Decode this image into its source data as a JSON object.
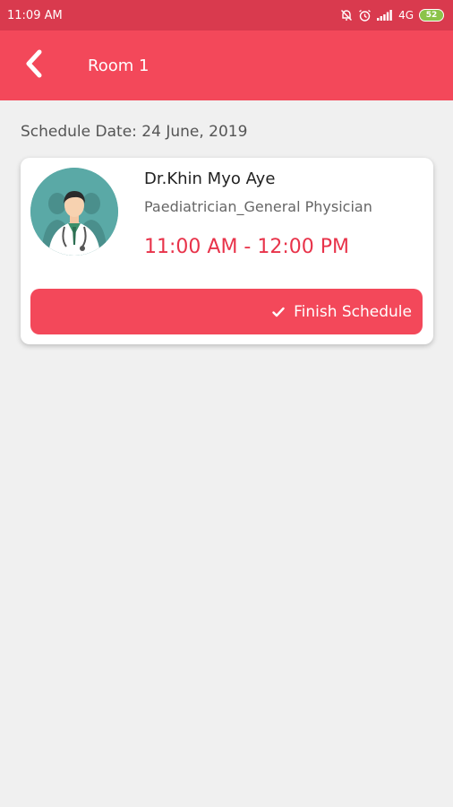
{
  "status_bar": {
    "time": "11:09 AM",
    "network": "4G",
    "battery": "52"
  },
  "header": {
    "title": "Room 1"
  },
  "schedule": {
    "date_line": "Schedule Date: 24 June, 2019"
  },
  "appointment": {
    "doctor_name": "Dr.Khin Myo Aye",
    "speciality": "Paediatrician_General Physician",
    "time_range": "11:00 AM - 12:00 PM",
    "finish_label": "Finish Schedule"
  },
  "colors": {
    "status_bar": "#d93a4e",
    "primary": "#f3485a",
    "time_text": "#e8334a",
    "avatar_bg": "#5aa9a6"
  },
  "icons": [
    "bell-off-icon",
    "alarm-icon",
    "signal-icon",
    "battery-icon",
    "back-arrow-icon",
    "check-icon",
    "doctor-avatar"
  ]
}
